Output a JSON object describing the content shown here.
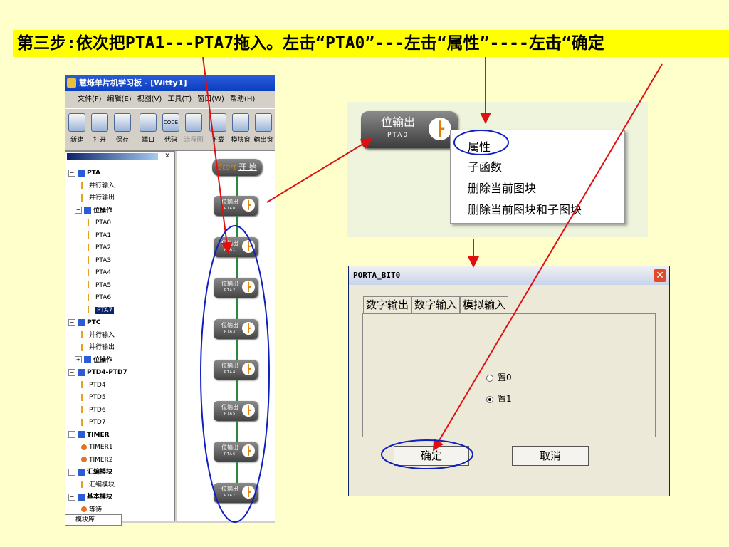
{
  "banner": {
    "text": "第三步:依次把PTA1---PTA7拖入。左击“PTA0”---左击“属性”----左击“确定"
  },
  "ide": {
    "title": "慧烁单片机学习板 - [Witty1]",
    "menu": [
      "文件(F)",
      "编辑(E)",
      "视图(V)",
      "工具(T)",
      "窗口(W)",
      "帮助(H)"
    ],
    "toolbar": [
      {
        "label": "新建",
        "icon": "new-icon"
      },
      {
        "label": "打开",
        "icon": "open-icon"
      },
      {
        "label": "保存",
        "icon": "save-icon"
      },
      {
        "label": "端口",
        "icon": "port-icon"
      },
      {
        "label": "代码",
        "icon": "code-icon"
      },
      {
        "label": "流程图",
        "icon": "flowchart-icon"
      },
      {
        "label": "下载",
        "icon": "download-icon"
      },
      {
        "label": "模块窗",
        "icon": "module-window-icon"
      },
      {
        "label": "输出窗",
        "icon": "output-window-icon"
      }
    ],
    "toolbar_icon_text": {
      "code": "CODE"
    },
    "close_label": "x",
    "tree": [
      {
        "label": "PTA",
        "pm": "−",
        "bold": true,
        "indent": 0
      },
      {
        "label": "并行输入",
        "indent": 2
      },
      {
        "label": "并行输出",
        "indent": 2
      },
      {
        "label": "位操作",
        "pm": "−",
        "bold": true,
        "indent": 1
      },
      {
        "label": "PTA0",
        "indent": 3
      },
      {
        "label": "PTA1",
        "indent": 3
      },
      {
        "label": "PTA2",
        "indent": 3
      },
      {
        "label": "PTA3",
        "indent": 3
      },
      {
        "label": "PTA4",
        "indent": 3
      },
      {
        "label": "PTA5",
        "indent": 3
      },
      {
        "label": "PTA6",
        "indent": 3
      },
      {
        "label": "PTA7",
        "indent": 3,
        "selected": true
      },
      {
        "label": "PTC",
        "pm": "−",
        "bold": true,
        "indent": 0
      },
      {
        "label": "并行输入",
        "indent": 2
      },
      {
        "label": "并行输出",
        "indent": 2
      },
      {
        "label": "位操作",
        "pm": "+",
        "bold": true,
        "indent": 1
      },
      {
        "label": "PTD4-PTD7",
        "pm": "−",
        "bold": true,
        "indent": 0
      },
      {
        "label": "PTD4",
        "indent": 2
      },
      {
        "label": "PTD5",
        "indent": 2
      },
      {
        "label": "PTD6",
        "indent": 2
      },
      {
        "label": "PTD7",
        "indent": 2
      },
      {
        "label": "TIMER",
        "pm": "−",
        "bold": true,
        "indent": 0
      },
      {
        "label": "TIMER1",
        "indent": 2,
        "clock": true
      },
      {
        "label": "TIMER2",
        "indent": 2,
        "clock": true
      },
      {
        "label": "汇编模块",
        "pm": "−",
        "bold": true,
        "indent": 0
      },
      {
        "label": "汇编模块",
        "indent": 2
      },
      {
        "label": "基本模块",
        "pm": "−",
        "bold": true,
        "indent": 0
      },
      {
        "label": "等待",
        "indent": 2,
        "clock": true
      }
    ],
    "bottom_tab": "模块库",
    "flow_start": {
      "italic": "Start",
      "label": "开 始"
    },
    "flow_blocks": [
      {
        "title": "位输出",
        "port": "PTA0"
      },
      {
        "title": "位输出",
        "port": "PTA1"
      },
      {
        "title": "位输出",
        "port": "PTA2"
      },
      {
        "title": "位输出",
        "port": "PTA3"
      },
      {
        "title": "位输出",
        "port": "PTA4"
      },
      {
        "title": "位输出",
        "port": "PTA5"
      },
      {
        "title": "位输出",
        "port": "PTA6"
      },
      {
        "title": "位输出",
        "port": "PTA7"
      }
    ]
  },
  "zoom_block": {
    "title": "位输出",
    "port": "PTA0"
  },
  "context_menu": {
    "items": [
      "属性",
      "子函数",
      "删除当前图块",
      "删除当前图块和子图块"
    ]
  },
  "dialog": {
    "title": "PORTA_BIT0",
    "close": "✕",
    "tabs": [
      "数字输出",
      "数字输入",
      "模拟输入"
    ],
    "radios": [
      {
        "label": "置0",
        "checked": false
      },
      {
        "label": "置1",
        "checked": true
      }
    ],
    "ok": "确定",
    "cancel": "取消"
  },
  "colors": {
    "annotation_red": "#E01010",
    "highlight_blue": "#1020C0",
    "banner_yellow": "#FFFF00",
    "background": "#FFFFCC"
  }
}
